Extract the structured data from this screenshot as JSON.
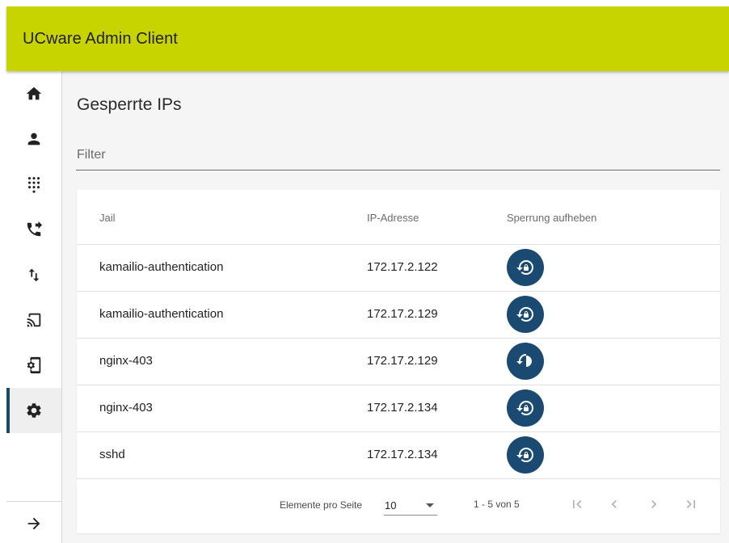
{
  "app": {
    "title": "UCware Admin Client"
  },
  "sidebar": {
    "items": [
      {
        "icon": "home-icon"
      },
      {
        "icon": "person-icon"
      },
      {
        "icon": "dialpad-icon"
      },
      {
        "icon": "phone-forward-icon"
      },
      {
        "icon": "swap-vert-icon"
      },
      {
        "icon": "cast-icon"
      },
      {
        "icon": "phonelink-setup-icon"
      },
      {
        "icon": "settings-icon",
        "active": true
      }
    ],
    "collapse_icon": "arrow-right-icon"
  },
  "page": {
    "title": "Gesperrte IPs",
    "filter_placeholder": "Filter"
  },
  "table": {
    "headers": [
      "Jail",
      "IP-Adresse",
      "Sperrung aufheben"
    ],
    "rows": [
      {
        "jail": "kamailio-authentication",
        "ip": "172.17.2.122"
      },
      {
        "jail": "kamailio-authentication",
        "ip": "172.17.2.129"
      },
      {
        "jail": "nginx-403",
        "ip": "172.17.2.129"
      },
      {
        "jail": "nginx-403",
        "ip": "172.17.2.134"
      },
      {
        "jail": "sshd",
        "ip": "172.17.2.134"
      }
    ],
    "action_icon": "lock-reset-icon"
  },
  "paginator": {
    "items_per_page_label": "Elemente pro Seite",
    "page_size": "10",
    "range_label": "1 - 5 von 5"
  },
  "colors": {
    "topbar": "#c8d400",
    "accent": "#1a4a72",
    "background": "#f5f5f5"
  }
}
